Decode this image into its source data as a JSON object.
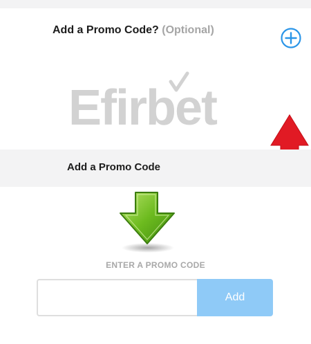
{
  "promo_header": {
    "title": "Add a Promo Code?",
    "optional": "(Optional)",
    "expand_icon": "plus-circle-icon"
  },
  "logo": {
    "text": "Efirbet"
  },
  "annotations": {
    "red_arrow": "arrow-up-icon",
    "green_arrow": "arrow-down-icon"
  },
  "promo_section": {
    "title": "Add a Promo Code",
    "field_label": "ENTER A PROMO CODE",
    "input_value": "",
    "input_placeholder": "",
    "add_label": "Add"
  },
  "colors": {
    "accent_blue": "#2a95e8",
    "add_button": "#8fcaf7",
    "red_arrow": "#e11a24",
    "green_arrow": "#5fae1c",
    "section_bg": "#f3f3f4"
  }
}
